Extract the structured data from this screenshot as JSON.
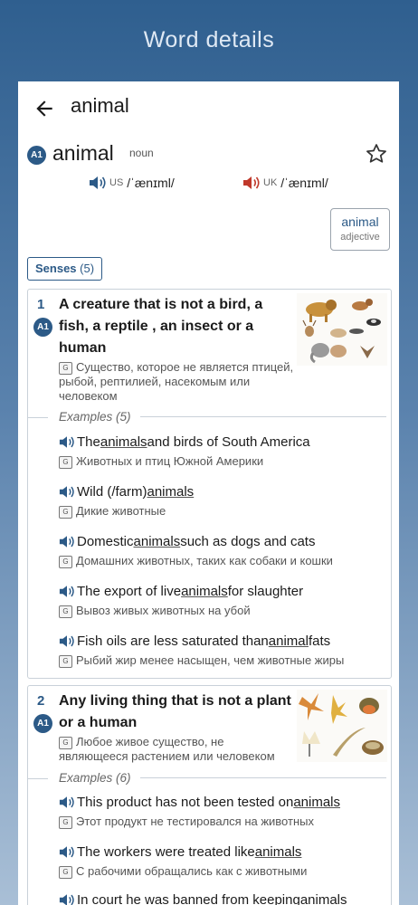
{
  "header": {
    "title": "Word details"
  },
  "top_bar": {
    "search_word": "animal"
  },
  "entry": {
    "level": "A1",
    "headword": "animal",
    "pos": "noun",
    "pron_us": {
      "region": "US",
      "ipa": "/ˈænɪml/"
    },
    "pron_uk": {
      "region": "UK",
      "ipa": "/ˈænɪml/"
    },
    "related": {
      "word": "animal",
      "pos": "adjective"
    },
    "senses_label": "Senses",
    "senses_count": "(5)"
  },
  "senses": [
    {
      "number": "1",
      "level": "A1",
      "definition": "A creature that is not a bird, a fish, a reptile , an insect or a human",
      "translation": "Существо, которое не является птицей, рыбой, рептилией, насекомым или человеком",
      "examples_label": "Examples",
      "examples_count": "(5)",
      "examples": [
        {
          "pre": "The ",
          "word": "animals",
          "post": " and birds of South America",
          "ru": "Животных и птиц Южной Америки"
        },
        {
          "pre": "Wild (/farm) ",
          "word": "animals",
          "post": "",
          "ru": "Дикие животные"
        },
        {
          "pre": "Domestic ",
          "word": "animals",
          "post": " such as dogs and cats",
          "ru": "Домашних животных, таких как собаки и кошки"
        },
        {
          "pre": "The export of live ",
          "word": "animals",
          "post": " for slaughter",
          "ru": "Вывоз живых животных на убой"
        },
        {
          "pre": "Fish oils are less saturated than ",
          "word": "animal",
          "post": " fats",
          "ru": "Рыбий жир менее насыщен, чем животные жиры"
        }
      ]
    },
    {
      "number": "2",
      "level": "A1",
      "definition": "Any living thing that is not a plant or a human",
      "translation": "Любое живое существо, не являющееся растением или человеком",
      "examples_label": "Examples",
      "examples_count": "(6)",
      "examples": [
        {
          "pre": "This product has not been tested on ",
          "word": "animals",
          "post": "",
          "ru": "Этот продукт не тестировался на животных"
        },
        {
          "pre": "The workers were treated like ",
          "word": "animals",
          "post": "",
          "ru": "С рабочими обращались как с животными"
        },
        {
          "pre": "In court he was banned from keeping ",
          "word": "animals",
          "post": "",
          "ru": ""
        }
      ]
    }
  ],
  "colors": {
    "accent": "#2c5a87",
    "uk_speaker": "#c0392b",
    "header_bg": "#2f5f8f"
  }
}
